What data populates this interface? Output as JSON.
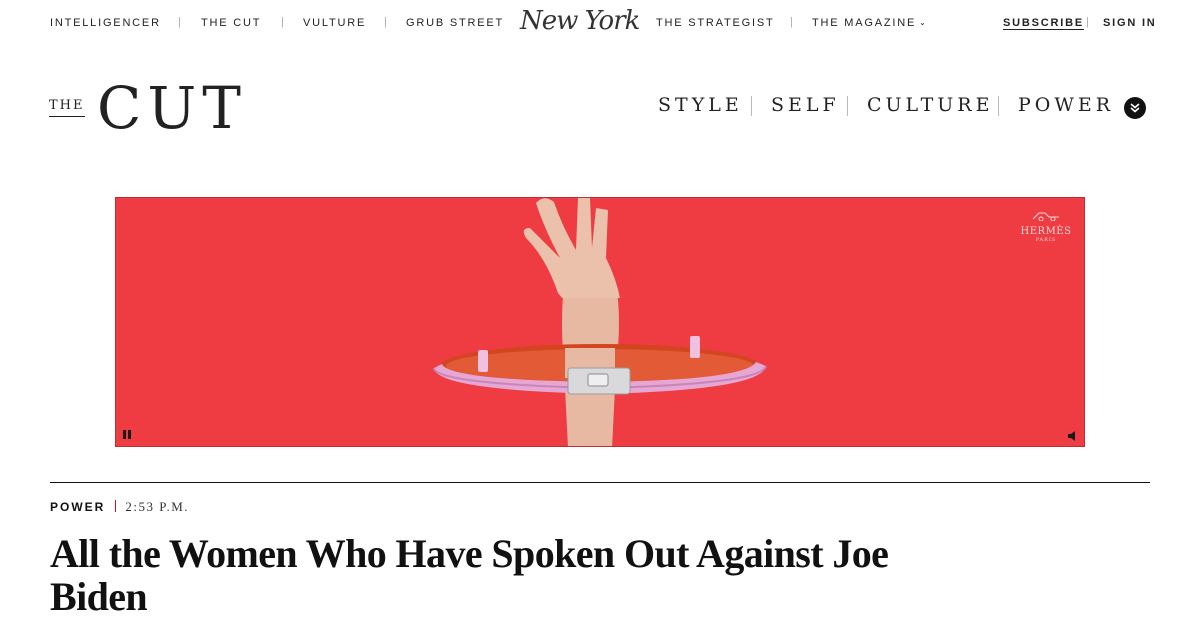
{
  "network_bar": {
    "links": [
      "INTELLIGENCER",
      "THE CUT",
      "VULTURE",
      "GRUB STREET",
      "THE STRATEGIST",
      "THE MAGAZINE"
    ],
    "logo": "New York",
    "subscribe": "SUBSCRIBE",
    "sign_in": "SIGN IN"
  },
  "site_header": {
    "logo_the": "THE",
    "logo_cut": "CUT",
    "sections": [
      "STYLE",
      "SELF",
      "CULTURE",
      "POWER"
    ],
    "menu_icon": "chevron-down-circle-icon"
  },
  "ad": {
    "brand": "HERMÈS",
    "brand_sub": "PARIS",
    "background": "#ef3b42"
  },
  "article": {
    "rubric": "POWER",
    "time": "2:53 P.M.",
    "headline": "All the Women Who Have Spoken Out Against Joe Biden"
  },
  "colors": {
    "accent": "#c8102e",
    "text": "#111111"
  }
}
